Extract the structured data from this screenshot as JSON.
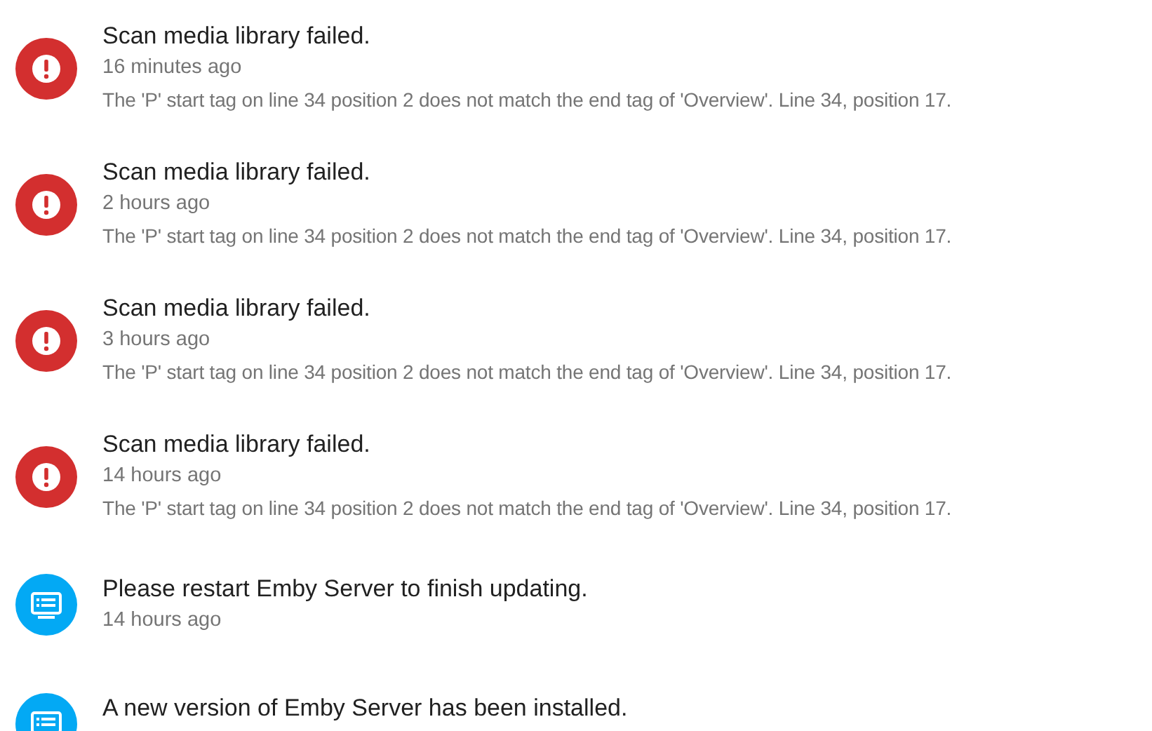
{
  "notifications": [
    {
      "kind": "error",
      "title": "Scan media library failed.",
      "time": "16 minutes ago",
      "detail": "The 'P' start tag on line 34 position 2 does not match the end tag of 'Overview'. Line 34, position 17."
    },
    {
      "kind": "error",
      "title": "Scan media library failed.",
      "time": "2 hours ago",
      "detail": "The 'P' start tag on line 34 position 2 does not match the end tag of 'Overview'. Line 34, position 17."
    },
    {
      "kind": "error",
      "title": "Scan media library failed.",
      "time": "3 hours ago",
      "detail": "The 'P' start tag on line 34 position 2 does not match the end tag of 'Overview'. Line 34, position 17."
    },
    {
      "kind": "error",
      "title": "Scan media library failed.",
      "time": "14 hours ago",
      "detail": "The 'P' start tag on line 34 position 2 does not match the end tag of 'Overview'. Line 34, position 17."
    },
    {
      "kind": "info",
      "title": "Please restart Emby Server to finish updating.",
      "time": "14 hours ago"
    },
    {
      "kind": "info",
      "title": "A new version of Emby Server has been installed."
    }
  ]
}
